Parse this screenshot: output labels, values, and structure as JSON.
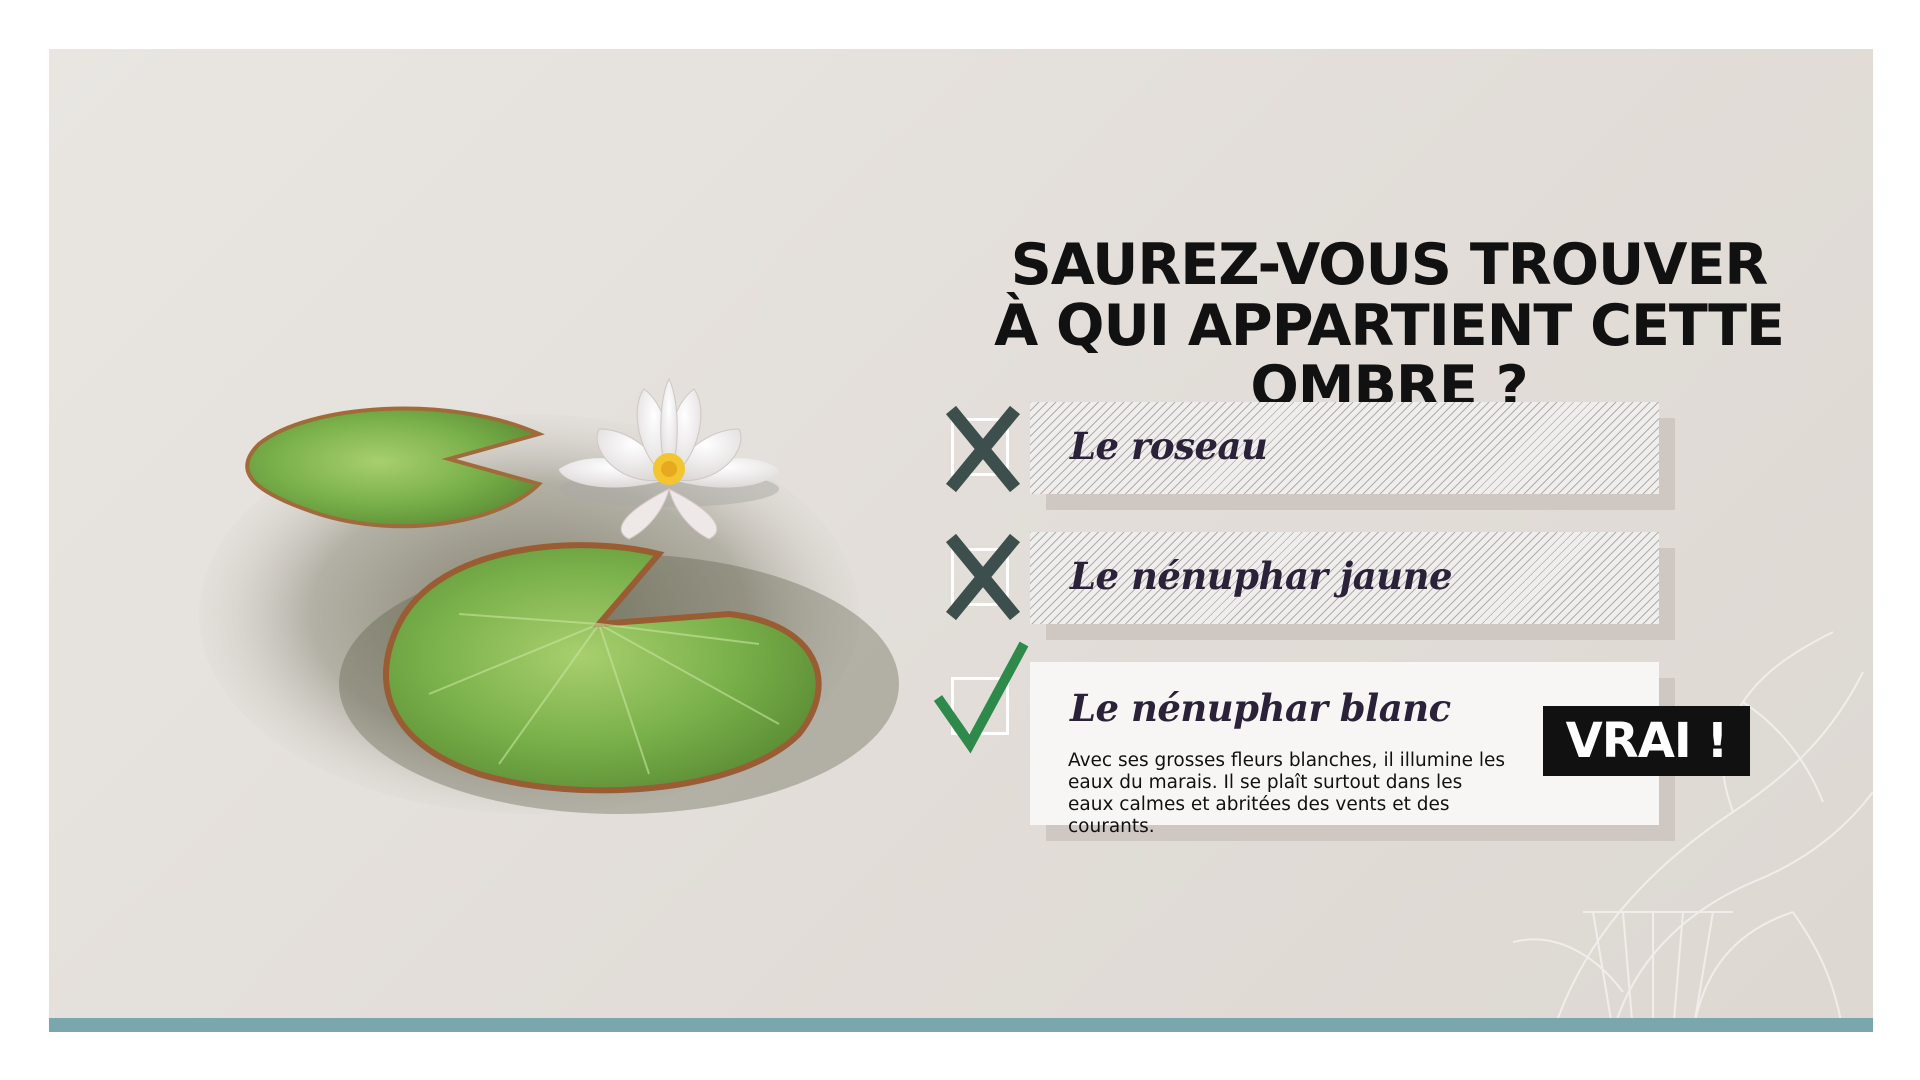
{
  "quiz": {
    "title_line1": "SAUREZ-VOUS TROUVER",
    "title_line2": "À QUI APPARTIENT CETTE OMBRE ?"
  },
  "options": [
    {
      "label": "Le roseau",
      "status": "incorrect",
      "icon": "x-mark-icon"
    },
    {
      "label": "Le nénuphar jaune",
      "status": "incorrect",
      "icon": "x-mark-icon"
    },
    {
      "label": "Le nénuphar blanc",
      "status": "correct",
      "icon": "checkmark-icon",
      "description": "Avec ses grosses fleurs blanches, il illumine les eaux du marais. Il se plaît surtout dans les eaux calmes et abritées des vents et des courants."
    }
  ],
  "result": {
    "label": "VRAI !"
  },
  "colors": {
    "background": "#e4e0dc",
    "accent_bar": "#7aa7ae",
    "x_mark": "#3d4f4c",
    "check_mark": "#2e8a4a",
    "label_text": "#2a2238"
  }
}
